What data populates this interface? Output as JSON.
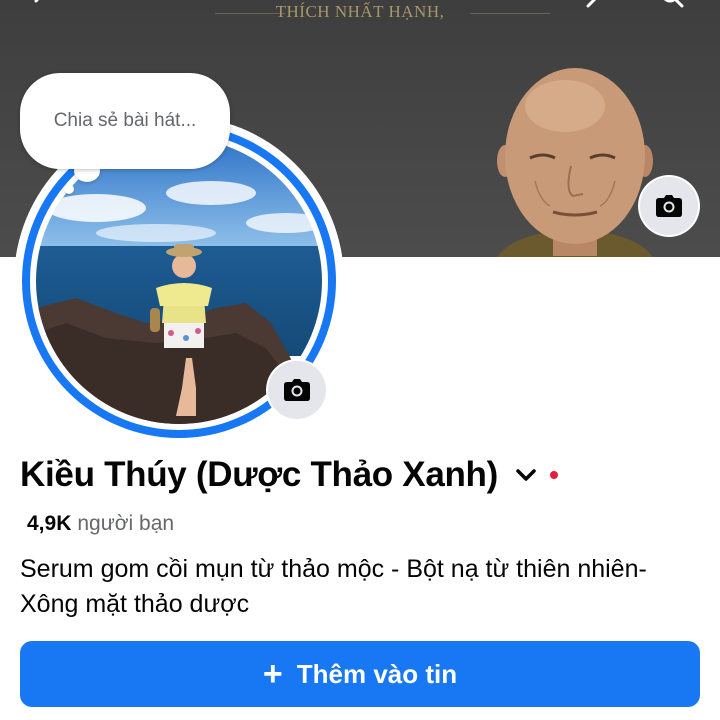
{
  "cover": {
    "caption": "THÍCH NHẤT HẠNH,",
    "camera_icon": "camera-icon"
  },
  "profile_picture": {
    "status_prompt": "Chia sẻ bài hát...",
    "camera_icon": "camera-icon"
  },
  "profile": {
    "name": "Kiều Thúy (Dược Thảo Xanh)",
    "friends_count": "4,9K",
    "friends_label": "người bạn",
    "bio": "Serum gom cồi mụn từ thảo mộc - Bột nạ từ thiên nhiên-Xông mặt thảo dược"
  },
  "actions": {
    "add_to_story_icon": "+",
    "add_to_story_label": "Thêm vào tin"
  },
  "colors": {
    "accent": "#1877f2",
    "story_ring": "#1877f2",
    "notification_dot": "#e41e3f",
    "cover_background": "#454545"
  }
}
